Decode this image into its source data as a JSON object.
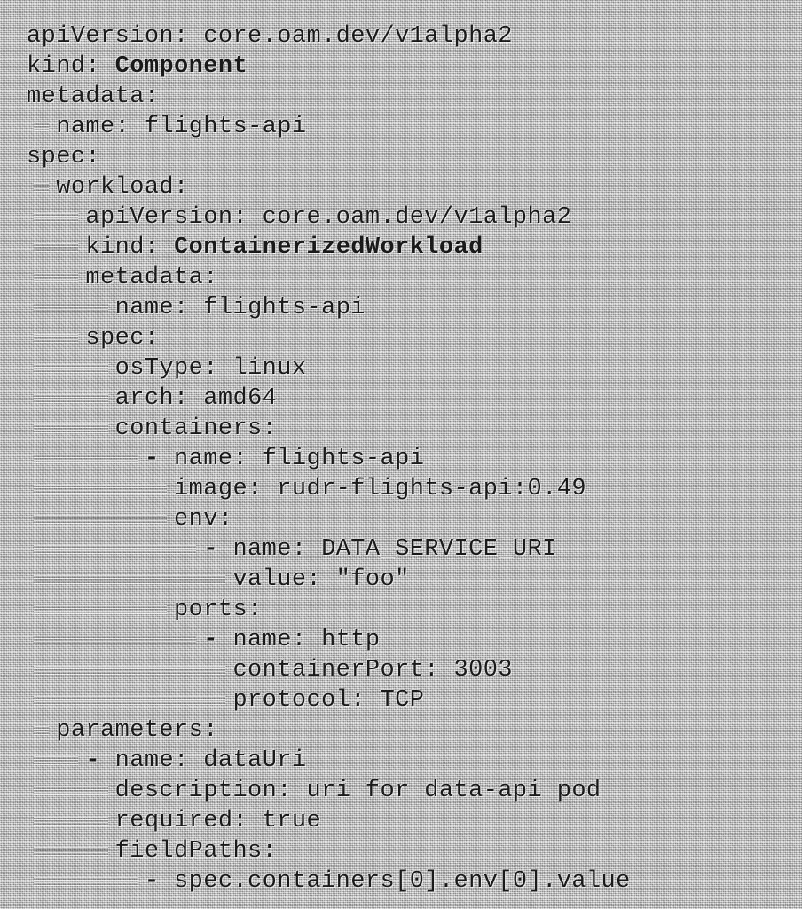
{
  "lines": [
    {
      "indent": "",
      "key": "apiVersion",
      "value": "core.oam.dev/v1alpha2",
      "bold": false
    },
    {
      "indent": "",
      "key": "kind",
      "value": "Component",
      "bold": true
    },
    {
      "indent": "",
      "key": "metadata",
      "value": "",
      "bold": false
    },
    {
      "indent": "  ",
      "key": "name",
      "value": "flights-api",
      "bold": false
    },
    {
      "indent": "",
      "key": "spec",
      "value": "",
      "bold": false
    },
    {
      "indent": "  ",
      "key": "workload",
      "value": "",
      "bold": false
    },
    {
      "indent": "    ",
      "key": "apiVersion",
      "value": "core.oam.dev/v1alpha2",
      "bold": false
    },
    {
      "indent": "    ",
      "key": "kind",
      "value": "ContainerizedWorkload",
      "bold": true
    },
    {
      "indent": "    ",
      "key": "metadata",
      "value": "",
      "bold": false
    },
    {
      "indent": "      ",
      "key": "name",
      "value": "flights-api",
      "bold": false
    },
    {
      "indent": "    ",
      "key": "spec",
      "value": "",
      "bold": false
    },
    {
      "indent": "      ",
      "key": "osType",
      "value": "linux",
      "bold": false
    },
    {
      "indent": "      ",
      "key": "arch",
      "value": "amd64",
      "bold": false
    },
    {
      "indent": "      ",
      "key": "containers",
      "value": "",
      "bold": false
    },
    {
      "indent": "        ",
      "dash": "- ",
      "key": "name",
      "value": "flights-api",
      "bold": false
    },
    {
      "indent": "          ",
      "key": "image",
      "value": "rudr-flights-api:0.49",
      "bold": false
    },
    {
      "indent": "          ",
      "key": "env",
      "value": "",
      "bold": false
    },
    {
      "indent": "            ",
      "dash": "- ",
      "key": "name",
      "value": "DATA_SERVICE_URI",
      "bold": false
    },
    {
      "indent": "              ",
      "key": "value",
      "value": "\"foo\"",
      "bold": false
    },
    {
      "indent": "          ",
      "key": "ports",
      "value": "",
      "bold": false
    },
    {
      "indent": "            ",
      "dash": "- ",
      "key": "name",
      "value": "http",
      "bold": false
    },
    {
      "indent": "              ",
      "key": "containerPort",
      "value": "3003",
      "bold": false
    },
    {
      "indent": "              ",
      "key": "protocol",
      "value": "TCP",
      "bold": false
    },
    {
      "indent": "  ",
      "key": "parameters",
      "value": "",
      "bold": false
    },
    {
      "indent": "    ",
      "dash": "- ",
      "key": "name",
      "value": "dataUri",
      "bold": false
    },
    {
      "indent": "      ",
      "key": "description",
      "value": "uri for data-api pod",
      "bold": false
    },
    {
      "indent": "      ",
      "key": "required",
      "value": "true",
      "bold": false
    },
    {
      "indent": "      ",
      "key": "fieldPaths",
      "value": "",
      "bold": false
    },
    {
      "indent": "        ",
      "dash": "- ",
      "key": "",
      "value": "spec.containers[0].env[0].value",
      "bold": false
    }
  ]
}
